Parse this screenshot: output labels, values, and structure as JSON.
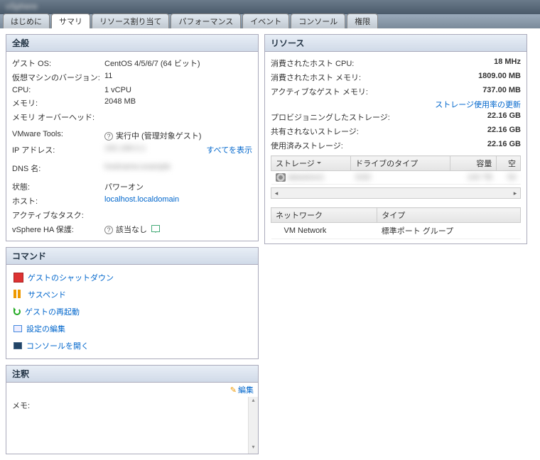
{
  "title": "vSphere",
  "tabs": [
    "はじめに",
    "サマリ",
    "リソース割り当て",
    "パフォーマンス",
    "イベント",
    "コンソール",
    "権限"
  ],
  "activeTab": 1,
  "general": {
    "header": "全般",
    "guestOs": {
      "label": "ゲスト OS:",
      "value": "CentOS 4/5/6/7 (64 ビット)"
    },
    "vmVersion": {
      "label": "仮想マシンのバージョン:",
      "value": "11"
    },
    "cpu": {
      "label": "CPU:",
      "value": "1 vCPU"
    },
    "memory": {
      "label": "メモリ:",
      "value": "2048 MB"
    },
    "memOverhead": {
      "label": "メモリ オーバーヘッド:",
      "value": ""
    },
    "vmwareTools": {
      "label": "VMware Tools:",
      "value": "実行中 (管理対象ゲスト)"
    },
    "ipAddr": {
      "label": "IP アドレス:",
      "value": "blurred",
      "link": "すべてを表示"
    },
    "dnsName": {
      "label": "DNS 名:",
      "value": "blurred"
    },
    "state": {
      "label": "状態:",
      "value": "パワーオン"
    },
    "host": {
      "label": "ホスト:",
      "value": "localhost.localdomain"
    },
    "activeTask": {
      "label": "アクティブなタスク:",
      "value": ""
    },
    "haProtect": {
      "label": "vSphere HA 保護:",
      "value": "該当なし"
    }
  },
  "commands": {
    "header": "コマンド",
    "items": [
      "ゲストのシャットダウン",
      "サスペンド",
      "ゲストの再起動",
      "設定の編集",
      "コンソールを開く"
    ]
  },
  "annotations": {
    "header": "注釈",
    "editLabel": "編集",
    "memoLabel": "メモ:"
  },
  "resources": {
    "header": "リソース",
    "hostCpu": {
      "label": "消費されたホスト CPU:",
      "value": "18 MHz"
    },
    "hostMem": {
      "label": "消費されたホスト メモリ:",
      "value": "1809.00 MB"
    },
    "guestMem": {
      "label": "アクティブなゲスト メモリ:",
      "value": "737.00 MB"
    },
    "refreshLink": "ストレージ使用率の更新",
    "provStorage": {
      "label": "プロビジョニングしたストレージ:",
      "value": "22.16 GB"
    },
    "unsharedStorage": {
      "label": "共有されないストレージ:",
      "value": "22.16 GB"
    },
    "usedStorage": {
      "label": "使用済みストレージ:",
      "value": "22.16 GB"
    },
    "storageHdr": {
      "c1": "ストレージ",
      "c2": "ドライブのタイプ",
      "c3": "容量",
      "c4": "空"
    },
    "networkHdr": {
      "c1": "ネットワーク",
      "c2": "タイプ"
    },
    "networkRow": {
      "name": "VM Network",
      "type": "標準ポート グループ"
    }
  }
}
